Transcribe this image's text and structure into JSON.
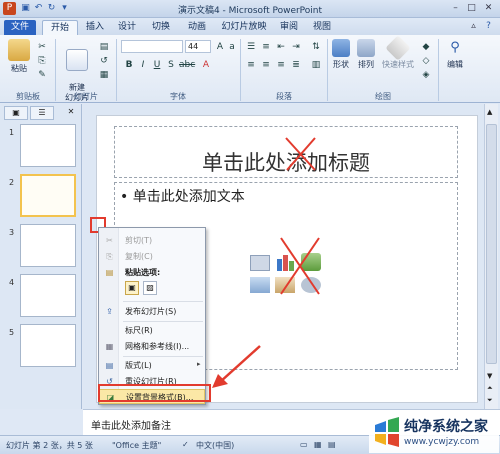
{
  "window": {
    "title": "演示文稿4 - Microsoft PowerPoint",
    "controls": [
      "–",
      "□",
      "✕"
    ]
  },
  "tabs": [
    "文件",
    "开始",
    "插入",
    "设计",
    "切换",
    "动画",
    "幻灯片放映",
    "审阅",
    "视图"
  ],
  "ribbon": {
    "groups": {
      "clipboard": "剪贴板",
      "slides": "幻灯片",
      "font": "字体",
      "paragraph": "段落",
      "drawing": "绘图"
    },
    "buttons": {
      "paste": "粘贴",
      "new_slide": "新建\n幻灯片",
      "shape": "形状",
      "arrange": "排列",
      "quick_styles": "快速样式",
      "editing": "编辑"
    },
    "font_size": "44",
    "font_buttons": [
      "B",
      "I",
      "U",
      "S",
      "abc"
    ]
  },
  "left_pane": {
    "tabs": [
      "☰",
      "▣"
    ],
    "slides": [
      {
        "num": "1",
        "selected": false
      },
      {
        "num": "2",
        "selected": true
      },
      {
        "num": "3",
        "selected": false
      },
      {
        "num": "4",
        "selected": false
      },
      {
        "num": "5",
        "selected": false
      }
    ]
  },
  "slide": {
    "title_placeholder": "单击此处添加标题",
    "body_placeholder": "• 单击此处添加文本"
  },
  "context_menu": {
    "items": [
      {
        "label": "剪切(T)",
        "disabled": true
      },
      {
        "label": "复制(C)",
        "disabled": true
      },
      {
        "label": "粘贴选项:",
        "disabled": false
      },
      {
        "label": "发布幻灯片(S)",
        "disabled": false
      },
      {
        "label": "标尺(R)",
        "disabled": false
      },
      {
        "label": "网格和参考线(I)...",
        "disabled": false
      },
      {
        "label": "版式(L)",
        "disabled": false
      },
      {
        "label": "重设幻灯片(R)",
        "disabled": false
      },
      {
        "label": "设置背景格式(B)...",
        "disabled": false
      }
    ]
  },
  "notes": {
    "placeholder": "单击此处添加备注"
  },
  "status": {
    "slide_info": "幻灯片 第 2 张，共 5 张",
    "theme": "\"Office 主题\"",
    "language": "中文(中国)"
  },
  "watermark": {
    "title": "纯净系统之家",
    "url": "www.ycwjzy.com"
  },
  "colors": {
    "file_tab": "#2b63c1",
    "annotation_red": "#e23b2e",
    "selected_thumb": "#f3c34e"
  }
}
